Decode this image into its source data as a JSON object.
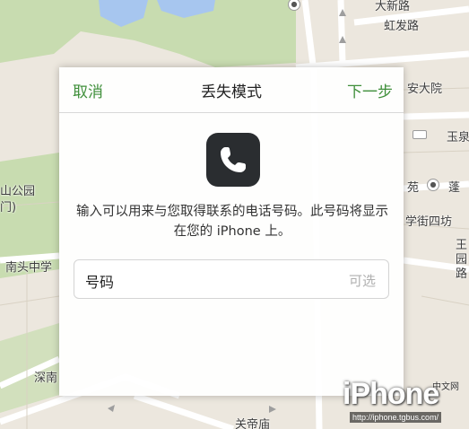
{
  "map": {
    "labels": {
      "top_right_1": "大新路",
      "top_right_2": "虹发路",
      "right_1": "安大院",
      "right_2": "玉泉",
      "right_3": "苑",
      "right_4": "蓬",
      "right_5": "学街四坊",
      "right_6": "王",
      "right_7": "园",
      "right_8": "路",
      "left_1": "山公园",
      "left_2": "门)",
      "left_3": "南头中学",
      "left_4": "深南",
      "bottom_1": "关帝庙"
    }
  },
  "dialog": {
    "cancel_label": "取消",
    "title": "丢失模式",
    "next_label": "下一步",
    "description": "输入可以用来与您取得联系的电话号码。此号码将显示在您的 iPhone 上。",
    "phone_field": {
      "label": "号码",
      "optional_hint": "可选"
    }
  },
  "watermark": {
    "logo_text": "iPhone",
    "tag": "中文网",
    "url": "http://iphone.tgbus.com/"
  },
  "colors": {
    "accent_green": "#3f8f3a",
    "icon_bg": "#2a2d30"
  }
}
